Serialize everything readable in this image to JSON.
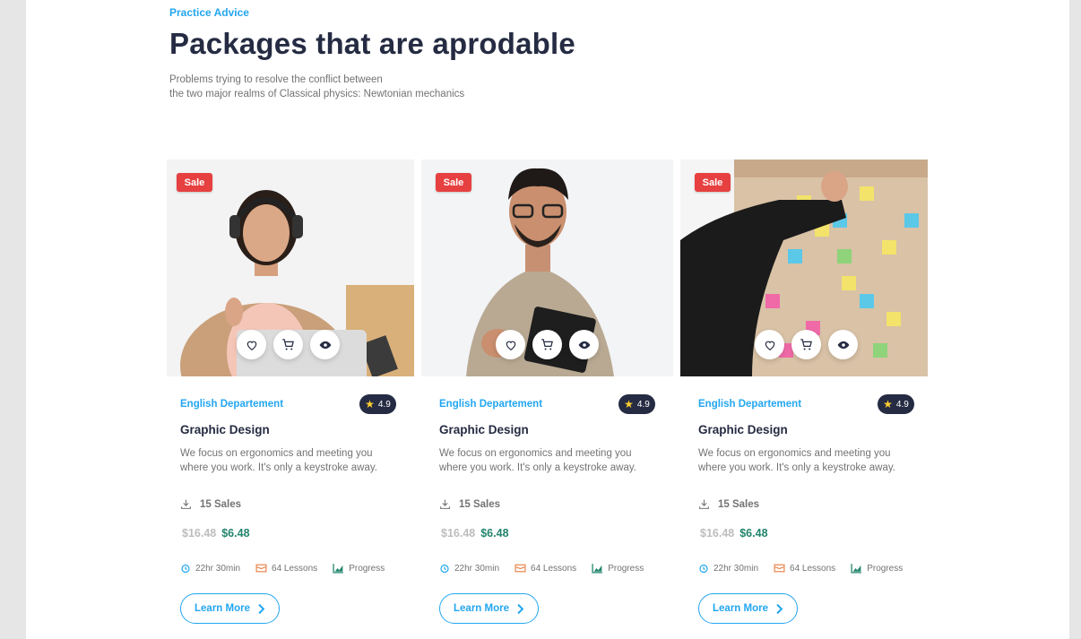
{
  "header": {
    "eyebrow": "Practice Advice",
    "title": "Packages that are aprodable",
    "subtitle_line1": "Problems trying to resolve the conflict between",
    "subtitle_line2": "the two major realms of Classical physics: Newtonian mechanics"
  },
  "colors": {
    "primary": "#23a6f0",
    "dark": "#252b42",
    "sale": "#e74040",
    "price_new": "#23856d",
    "price_old": "#bdbdbd",
    "muted": "#737373"
  },
  "cards": [
    {
      "badge": "Sale",
      "department": "English Departement",
      "rating": "4.9",
      "title": "Graphic Design",
      "description": "We focus on ergonomics and meeting you where you work. It's only a keystroke away.",
      "sales": "15 Sales",
      "old_price": "$16.48",
      "new_price": "$6.48",
      "duration": "22hr 30min",
      "lessons": "64 Lessons",
      "progress": "Progress",
      "cta": "Learn More",
      "image": "woman-with-headphones-at-laptop"
    },
    {
      "badge": "Sale",
      "department": "English Departement",
      "rating": "4.9",
      "title": "Graphic Design",
      "description": "We focus on ergonomics and meeting you where you work. It's only a keystroke away.",
      "sales": "15 Sales",
      "old_price": "$16.48",
      "new_price": "$6.48",
      "duration": "22hr 30min",
      "lessons": "64 Lessons",
      "progress": "Progress",
      "cta": "Learn More",
      "image": "man-with-glasses-holding-notebook"
    },
    {
      "badge": "Sale",
      "department": "English Departement",
      "rating": "4.9",
      "title": "Graphic Design",
      "description": "We focus on ergonomics and meeting you where you work. It's only a keystroke away.",
      "sales": "15 Sales",
      "old_price": "$16.48",
      "new_price": "$6.48",
      "duration": "22hr 30min",
      "lessons": "64 Lessons",
      "progress": "Progress",
      "cta": "Learn More",
      "image": "hand-placing-sticky-notes-on-board"
    }
  ],
  "icons": {
    "wishlist": "heart-icon",
    "cart": "cart-icon",
    "preview": "eye-icon",
    "sales": "download-icon",
    "duration": "alarm-clock-icon",
    "lessons": "book-icon",
    "progress": "chart-icon",
    "cta": "chevron-right-icon",
    "rating": "star-icon"
  }
}
